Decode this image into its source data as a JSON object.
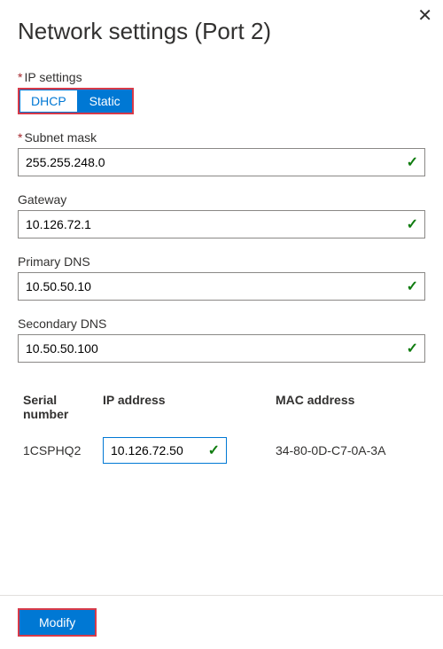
{
  "title": "Network settings (Port 2)",
  "fields": {
    "ip_settings": {
      "label": "IP settings",
      "required": true,
      "options": {
        "dhcp": "DHCP",
        "static": "Static"
      },
      "selected": "static"
    },
    "subnet_mask": {
      "label": "Subnet mask",
      "required": true,
      "value": "255.255.248.0",
      "valid": true
    },
    "gateway": {
      "label": "Gateway",
      "required": false,
      "value": "10.126.72.1",
      "valid": true
    },
    "primary_dns": {
      "label": "Primary DNS",
      "required": false,
      "value": "10.50.50.10",
      "valid": true
    },
    "secondary_dns": {
      "label": "Secondary DNS",
      "required": false,
      "value": "10.50.50.100",
      "valid": true
    }
  },
  "table": {
    "headers": {
      "serial": "Serial number",
      "ip": "IP address",
      "mac": "MAC address"
    },
    "rows": [
      {
        "serial": "1CSPHQ2",
        "ip": "10.126.72.50",
        "ip_valid": true,
        "mac": "34-80-0D-C7-0A-3A"
      }
    ]
  },
  "buttons": {
    "modify": "Modify"
  },
  "checkmark": "✓"
}
